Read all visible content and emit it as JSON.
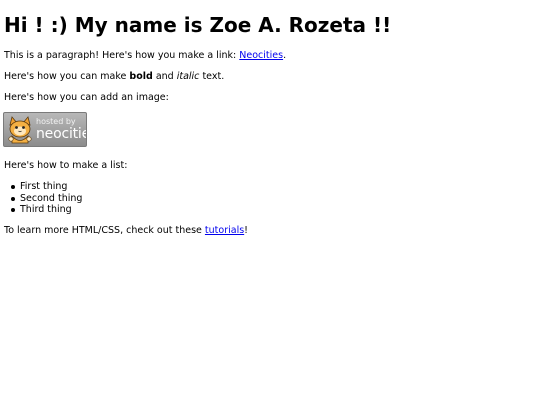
{
  "heading": "Hi ! :) My name is Zoe A. Rozeta !!",
  "paragraph1": {
    "text": "This is a paragraph! Here's how you make a link: ",
    "link": "Neocities",
    "after": "."
  },
  "paragraph2": {
    "before": "Here's how you can make ",
    "bold": "bold",
    "middle": " and ",
    "italic": "italic",
    "after": " text."
  },
  "paragraph3": "Here's how you can add an image:",
  "badge": {
    "small_text": "hosted by",
    "big_text": "neocities"
  },
  "paragraph4": "Here's how to make a list:",
  "list": [
    "First thing",
    "Second thing",
    "Third thing"
  ],
  "paragraph5": {
    "before": "To learn more HTML/CSS, check out these ",
    "link": "tutorials",
    "after": "!"
  },
  "colors": {
    "link": "#0000ee",
    "text": "#000000",
    "badge_bg": "#a3a3a3"
  }
}
